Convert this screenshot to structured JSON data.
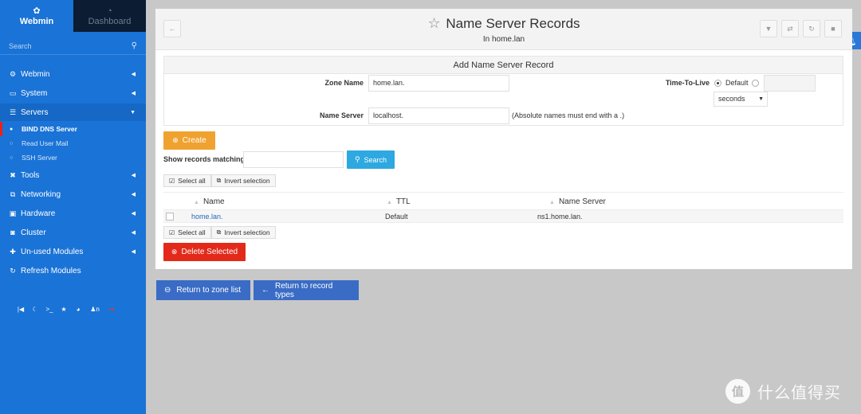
{
  "sidebar": {
    "tabs": [
      {
        "label": "Webmin",
        "icon": "webmin-logo-icon"
      },
      {
        "label": "Dashboard",
        "icon": "dashboard-gauge-icon"
      }
    ],
    "search_placeholder": "Search",
    "nav": [
      {
        "label": "Webmin",
        "icon": "gear-icon"
      },
      {
        "label": "System",
        "icon": "monitor-icon"
      },
      {
        "label": "Servers",
        "icon": "server-list-icon"
      },
      {
        "label": "Tools",
        "icon": "wrench-icon"
      },
      {
        "label": "Networking",
        "icon": "network-icon"
      },
      {
        "label": "Hardware",
        "icon": "hdd-icon"
      },
      {
        "label": "Cluster",
        "icon": "cluster-icon"
      },
      {
        "label": "Un-used Modules",
        "icon": "puzzle-icon"
      },
      {
        "label": "Refresh Modules",
        "icon": "refresh-icon"
      }
    ],
    "server_items": [
      "BIND DNS Server",
      "Read User Mail",
      "SSH Server"
    ],
    "tools_note": "n",
    "accent": "#1a73d6",
    "dark_tab": "#0b1c33"
  },
  "header": {
    "title": "Name Server Records",
    "subtitle": "In home.lan"
  },
  "form": {
    "title": "Add Name Server Record",
    "zone_name_label": "Zone Name",
    "zone_name_value": "home.lan.",
    "ttl_label": "Time-To-Live",
    "ttl_default_label": "Default",
    "ttl_unit": "seconds",
    "name_server_label": "Name Server",
    "name_server_value": "localhost.",
    "name_server_note": "(Absolute names must end with a .)"
  },
  "actions": {
    "create": "Create",
    "search_label": "Show records matching:",
    "search": "Search",
    "select_all": "Select all",
    "invert_selection": "Invert selection",
    "delete_selected": "Delete Selected",
    "return_zone": "Return to zone list",
    "return_types": "Return to record types"
  },
  "table": {
    "headers": [
      "Name",
      "TTL",
      "Name Server"
    ],
    "rows": [
      {
        "name": "home.lan.",
        "ttl": "Default",
        "server": "ns1.home.lan."
      }
    ]
  },
  "watermark": "什么值得买",
  "colors": {
    "create": "#f0a230",
    "search": "#2ea8e0",
    "delete": "#e32a1a",
    "return": "#3a6cc6"
  }
}
